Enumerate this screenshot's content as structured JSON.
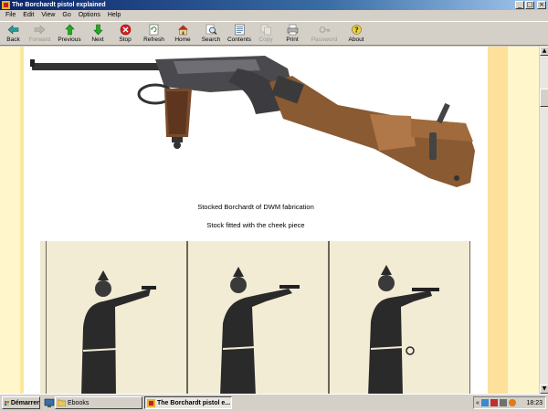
{
  "window": {
    "title": "The Borchardt pistol explained",
    "controls": [
      "minimize",
      "maximize",
      "close"
    ]
  },
  "menu": [
    "File",
    "Edit",
    "View",
    "Go",
    "Options",
    "Help"
  ],
  "toolbar": [
    {
      "label": "Back",
      "icon": "back-arrow-icon",
      "enabled": true
    },
    {
      "label": "Forward",
      "icon": "forward-arrow-icon",
      "enabled": false
    },
    {
      "label": "Previous",
      "icon": "previous-icon",
      "enabled": true
    },
    {
      "label": "Next",
      "icon": "next-icon",
      "enabled": true
    },
    {
      "label": "Stop",
      "icon": "stop-icon",
      "enabled": true
    },
    {
      "label": "Refresh",
      "icon": "refresh-icon",
      "enabled": true
    },
    {
      "label": "Home",
      "icon": "home-icon",
      "enabled": true
    },
    {
      "label": "Search",
      "icon": "search-icon",
      "enabled": true
    },
    {
      "label": "Contents",
      "icon": "contents-icon",
      "enabled": true
    },
    {
      "label": "Copy",
      "icon": "copy-icon",
      "enabled": false
    },
    {
      "label": "Print",
      "icon": "print-icon",
      "enabled": true
    },
    {
      "label": "Password",
      "icon": "key-icon",
      "enabled": false
    },
    {
      "label": "About",
      "icon": "question-icon",
      "enabled": true
    }
  ],
  "page": {
    "caption_1": "Stocked Borchardt of DWM fabrication",
    "caption_2": "Stock fitted with the cheek piece",
    "colors": {
      "page_bg": "#ffffff",
      "margin_light": "#fff6cc",
      "margin_dark": "#fde09a"
    }
  },
  "taskbar": {
    "start_label": "Démarrer",
    "tasks": [
      {
        "label": "Ebooks",
        "icon": "folder-icon",
        "active": false
      },
      {
        "label": "The Borchardt pistol e...",
        "icon": "ebook-icon",
        "active": true
      }
    ],
    "clock": "18:23"
  }
}
